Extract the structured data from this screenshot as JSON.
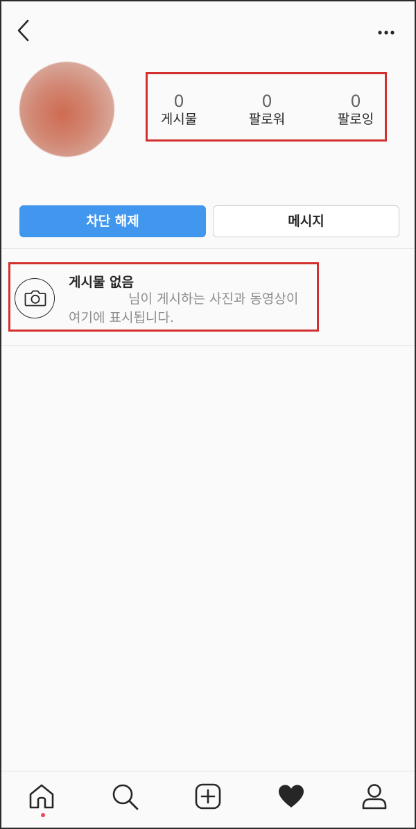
{
  "header": {
    "back_icon": "chevron-left-icon",
    "more_icon": "more-horizontal-icon"
  },
  "profile": {
    "avatar": "blurred-avatar-image"
  },
  "stats": [
    {
      "count": "0",
      "label": "게시물"
    },
    {
      "count": "0",
      "label": "팔로워"
    },
    {
      "count": "0",
      "label": "팔로잉"
    }
  ],
  "actions": {
    "unblock_label": "차단 해제",
    "message_label": "메시지"
  },
  "empty_state": {
    "icon": "camera-icon",
    "title": "게시물 없음",
    "desc_line1": "님이 게시하는 사진과 동영상이",
    "desc_line2": "여기에 표시됩니다."
  },
  "tabbar": {
    "items": [
      "home-icon",
      "search-icon",
      "add-post-icon",
      "heart-icon",
      "profile-icon"
    ],
    "active": "home",
    "notification_dot_color": "#ed4956"
  },
  "colors": {
    "accent_blue": "#4196ee",
    "highlight_red": "#d32f2f"
  }
}
